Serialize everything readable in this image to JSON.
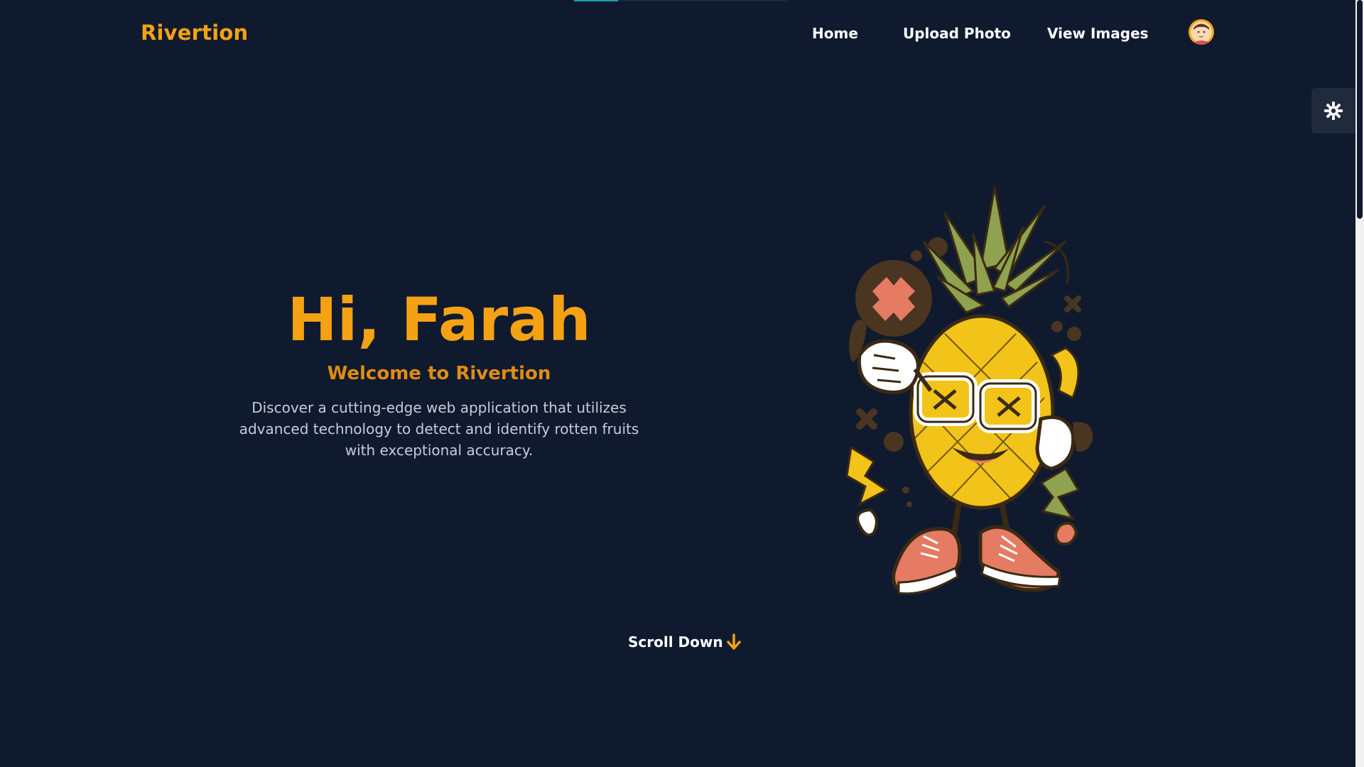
{
  "brand": {
    "name": "Rivertion",
    "accent": "#f4a214"
  },
  "nav": {
    "home": "Home",
    "upload": "Upload Photo",
    "view": "View Images"
  },
  "hero": {
    "greeting": "Hi, Farah",
    "subtitle": "Welcome to Rivertion",
    "description": "Discover a cutting-edge web application that utilizes advanced technology to detect and identify rotten fruits with exceptional accuracy."
  },
  "scroll": {
    "label": "Scroll Down"
  },
  "icons": {
    "theme": "gear-icon",
    "scroll": "arrow-down-icon",
    "avatar": "user-avatar",
    "illustration": "pineapple-mascot-illustration"
  },
  "colors": {
    "background": "#0f1a2f",
    "accent": "#f4a214",
    "subtitle": "#e08c12",
    "text": "#ffffff",
    "muted": "#c7ccd6"
  }
}
